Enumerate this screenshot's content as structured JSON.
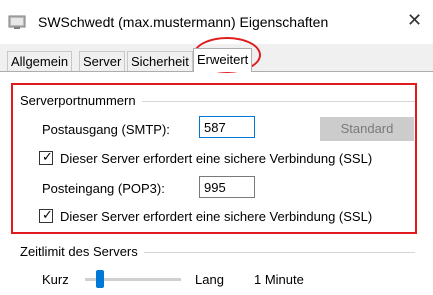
{
  "window": {
    "title": "SWSchwedt (max.mustermann) Eigenschaften",
    "icon": "mail-server-icon"
  },
  "tabs": [
    "Allgemein",
    "Server",
    "Sicherheit",
    "Erweitert"
  ],
  "active_tab": "Erweitert",
  "ports_group": {
    "label": "Serverportnummern",
    "smtp_label": "Postausgang (SMTP):",
    "smtp_value": "587",
    "standard_button": "Standard",
    "smtp_ssl_label": "Dieser Server erfordert eine sichere Verbindung (SSL)",
    "smtp_ssl_checked": true,
    "pop3_label": "Posteingang (POP3):",
    "pop3_value": "995",
    "pop3_ssl_label": "Dieser Server erfordert eine sichere Verbindung (SSL)",
    "pop3_ssl_checked": true
  },
  "timeout_group": {
    "label": "Zeitlimit des Servers",
    "short_label": "Kurz",
    "long_label": "Lang",
    "value_text": "1 Minute"
  },
  "colors": {
    "annotation": "#e01b1b",
    "accent": "#0078d7"
  }
}
